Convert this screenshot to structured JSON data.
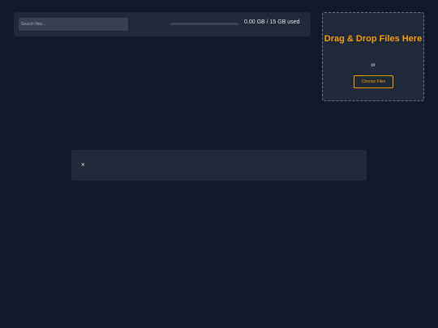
{
  "toolbar": {
    "search_placeholder": "Search files...",
    "storage_text": "0.00 GB / 15 GB used",
    "storage_used_fraction": 0.0
  },
  "dropzone": {
    "title": "Drag & Drop Files Here",
    "or_text": "or",
    "button_label": "Choose Files"
  },
  "panel": {
    "close_symbol": "×"
  },
  "colors": {
    "accent": "#f59e0b",
    "background": "#121a2a",
    "surface": "#1f2937"
  }
}
